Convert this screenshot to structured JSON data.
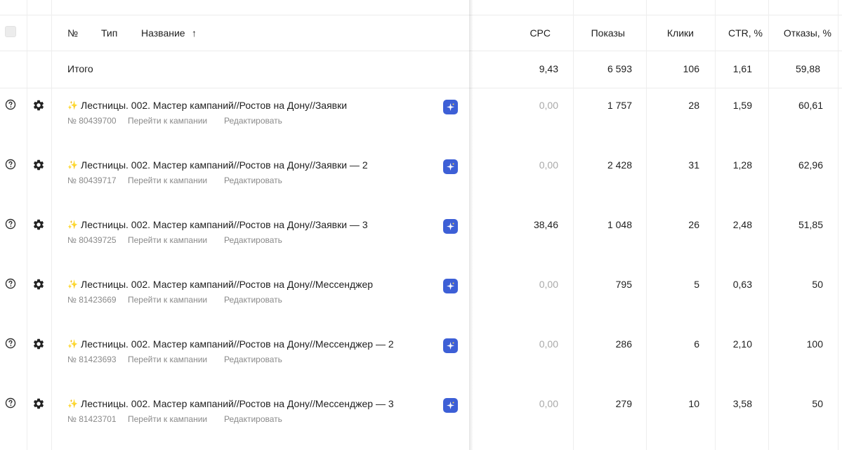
{
  "header": {
    "num_label": "№",
    "type_label": "Тип",
    "name_label": "Название",
    "sort_arrow": "↑",
    "cpc_label": "CPC",
    "shows_label": "Показы",
    "clicks_label": "Клики",
    "ctr_label": "CTR, %",
    "bounce_label": "Отказы, %"
  },
  "totals": {
    "label": "Итого",
    "cpc": "9,43",
    "shows": "6 593",
    "clicks": "106",
    "ctr": "1,61",
    "bounce": "59,88"
  },
  "rows": [
    {
      "name": "Лестницы. 002. Мастер кампаний//Ростов на Дону//Заявки",
      "id": "№ 80439700",
      "go_link": "Перейти к кампании",
      "edit_link": "Редактировать",
      "cpc": "0,00",
      "cpc_muted": true,
      "shows": "1 757",
      "clicks": "28",
      "ctr": "1,59",
      "bounce": "60,61"
    },
    {
      "name": "Лестницы. 002. Мастер кампаний//Ростов на Дону//Заявки  — 2",
      "id": "№ 80439717",
      "go_link": "Перейти к кампании",
      "edit_link": "Редактировать",
      "cpc": "0,00",
      "cpc_muted": true,
      "shows": "2 428",
      "clicks": "31",
      "ctr": "1,28",
      "bounce": "62,96"
    },
    {
      "name": "Лестницы. 002. Мастер кампаний//Ростов на Дону//Заявки  — 3",
      "id": "№ 80439725",
      "go_link": "Перейти к кампании",
      "edit_link": "Редактировать",
      "cpc": "38,46",
      "cpc_muted": false,
      "shows": "1 048",
      "clicks": "26",
      "ctr": "2,48",
      "bounce": "51,85"
    },
    {
      "name": "Лестницы. 002. Мастер кампаний//Ростов на Дону//Мессенджер",
      "id": "№ 81423669",
      "go_link": "Перейти к кампании",
      "edit_link": "Редактировать",
      "cpc": "0,00",
      "cpc_muted": true,
      "shows": "795",
      "clicks": "5",
      "ctr": "0,63",
      "bounce": "50"
    },
    {
      "name": "Лестницы. 002. Мастер кампаний//Ростов на Дону//Мессенджер — 2",
      "id": "№ 81423693",
      "go_link": "Перейти к кампании",
      "edit_link": "Редактировать",
      "cpc": "0,00",
      "cpc_muted": true,
      "shows": "286",
      "clicks": "6",
      "ctr": "2,10",
      "bounce": "100"
    },
    {
      "name": "Лестницы. 002. Мастер кампаний//Ростов на Дону//Мессенджер — 3",
      "id": "№ 81423701",
      "go_link": "Перейти к кампании",
      "edit_link": "Редактировать",
      "cpc": "0,00",
      "cpc_muted": true,
      "shows": "279",
      "clicks": "10",
      "ctr": "3,58",
      "bounce": "50"
    }
  ],
  "icons": {
    "help": "help-circle-icon",
    "settings": "gear-icon",
    "campaign_type": "master-campaign-icon",
    "ai_badge": "sparkle-icon"
  },
  "colors": {
    "ai_badge": "#3d5fd6",
    "muted_text": "#8a8a8a"
  }
}
